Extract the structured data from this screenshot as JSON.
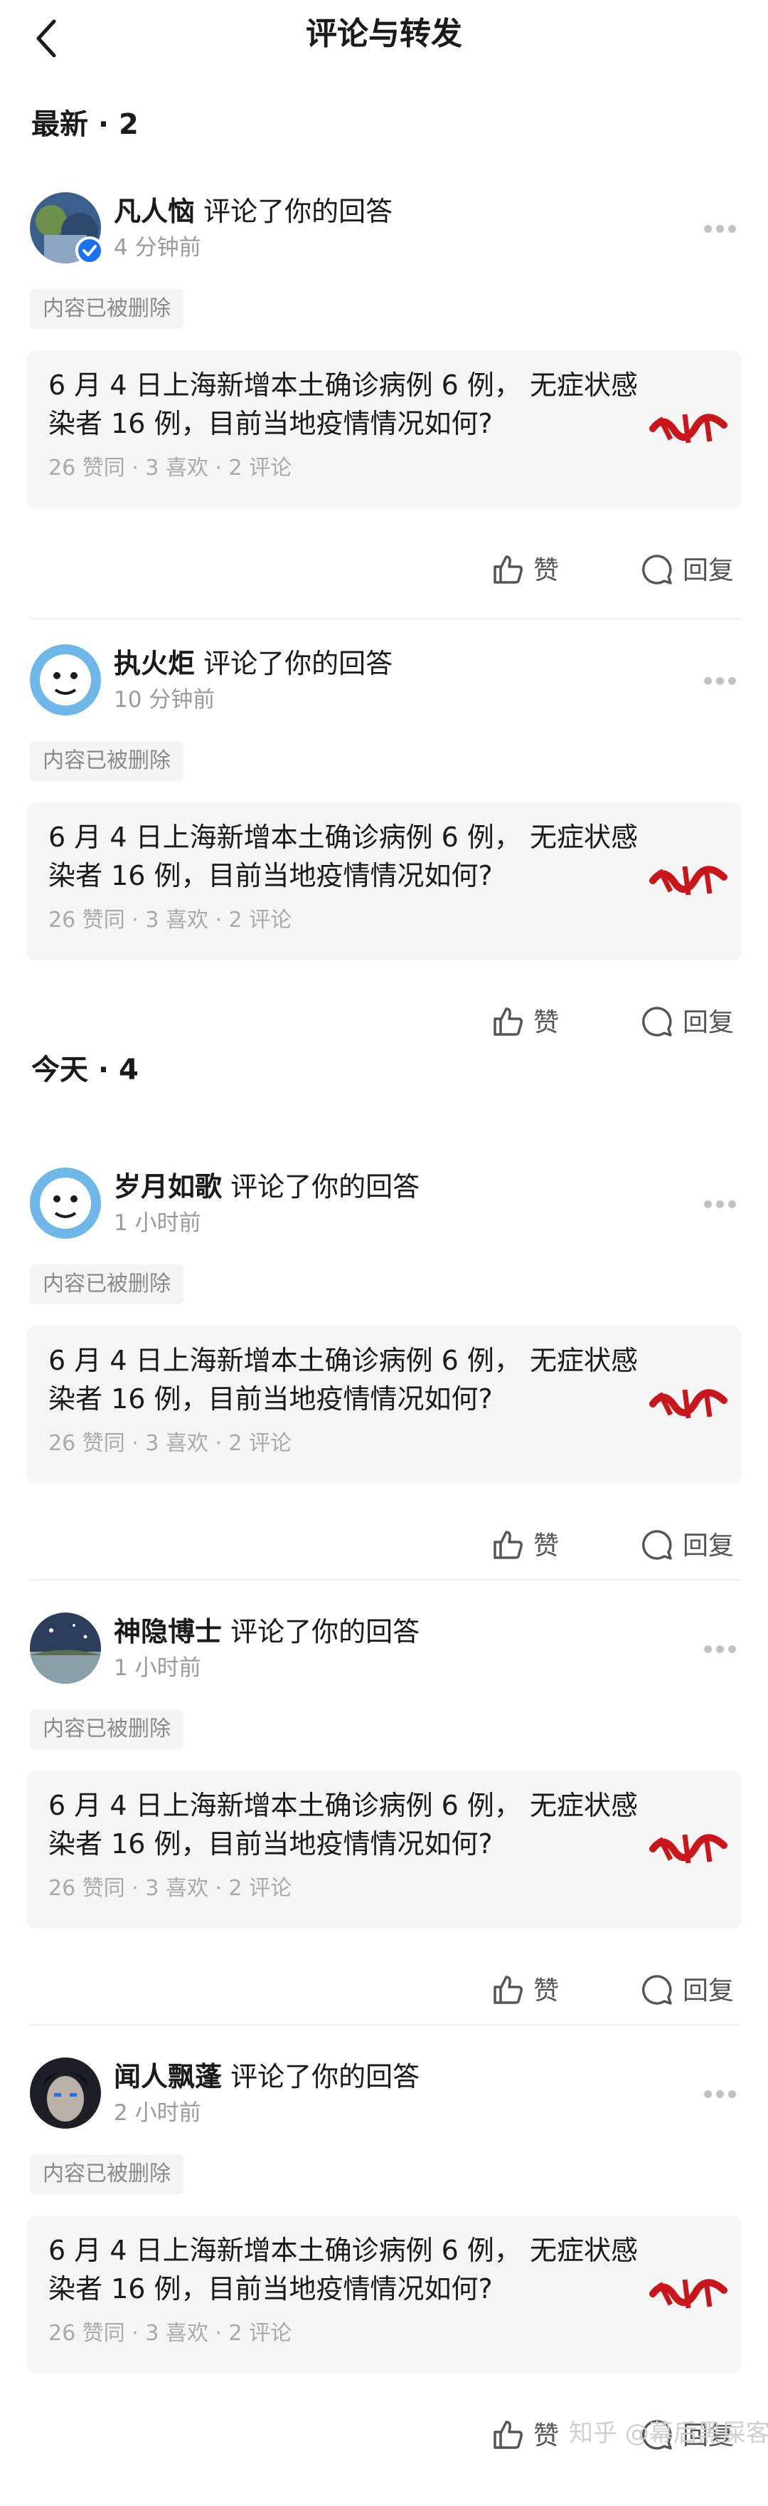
{
  "header": {
    "title": "评论与转发",
    "back_icon": "chevron-left-icon"
  },
  "sections": [
    {
      "label": "最新 · 2"
    },
    {
      "label": "今天 · 4"
    }
  ],
  "items": [
    {
      "username": "凡人恼",
      "action": "评论了你的回答",
      "time": "4 分钟前",
      "deleted_label": "内容已被删除",
      "question": "6 月 4 日上海新增本土确诊病例 6 例， 无症状感染者 16 例，目前当地疫情情况如何?",
      "stats": "26 赞同 · 3 喜欢 · 2 评论",
      "like_label": "赞",
      "reply_label": "回复"
    },
    {
      "username": "执火炬",
      "action": "评论了你的回答",
      "time": "10 分钟前",
      "deleted_label": "内容已被删除",
      "question": "6 月 4 日上海新增本土确诊病例 6 例， 无症状感染者 16 例，目前当地疫情情况如何?",
      "stats": "26 赞同 · 3 喜欢 · 2 评论",
      "like_label": "赞",
      "reply_label": "回复"
    },
    {
      "username": "岁月如歌",
      "action": "评论了你的回答",
      "time": "1 小时前",
      "deleted_label": "内容已被删除",
      "question": "6 月 4 日上海新增本土确诊病例 6 例， 无症状感染者 16 例，目前当地疫情情况如何?",
      "stats": "26 赞同 · 3 喜欢 · 2 评论",
      "like_label": "赞",
      "reply_label": "回复"
    },
    {
      "username": "神隐博士",
      "action": "评论了你的回答",
      "time": "1 小时前",
      "deleted_label": "内容已被删除",
      "question": "6 月 4 日上海新增本土确诊病例 6 例， 无症状感染者 16 例，目前当地疫情情况如何?",
      "stats": "26 赞同 · 3 喜欢 · 2 评论",
      "like_label": "赞",
      "reply_label": "回复"
    },
    {
      "username": "闻人飘蓬",
      "action": "评论了你的回答",
      "time": "2 小时前",
      "deleted_label": "内容已被删除",
      "question": "6 月 4 日上海新增本土确诊病例 6 例， 无症状感染者 16 例，目前当地疫情情况如何?",
      "stats": "26 赞同 · 3 喜欢 · 2 评论",
      "like_label": "赞",
      "reply_label": "回复"
    }
  ],
  "watermark": "知乎 @幕后黑屎客",
  "colors": {
    "verified": "#1772f6",
    "card_bg": "#f5f5f5",
    "muted_text": "#9a9a9a"
  }
}
